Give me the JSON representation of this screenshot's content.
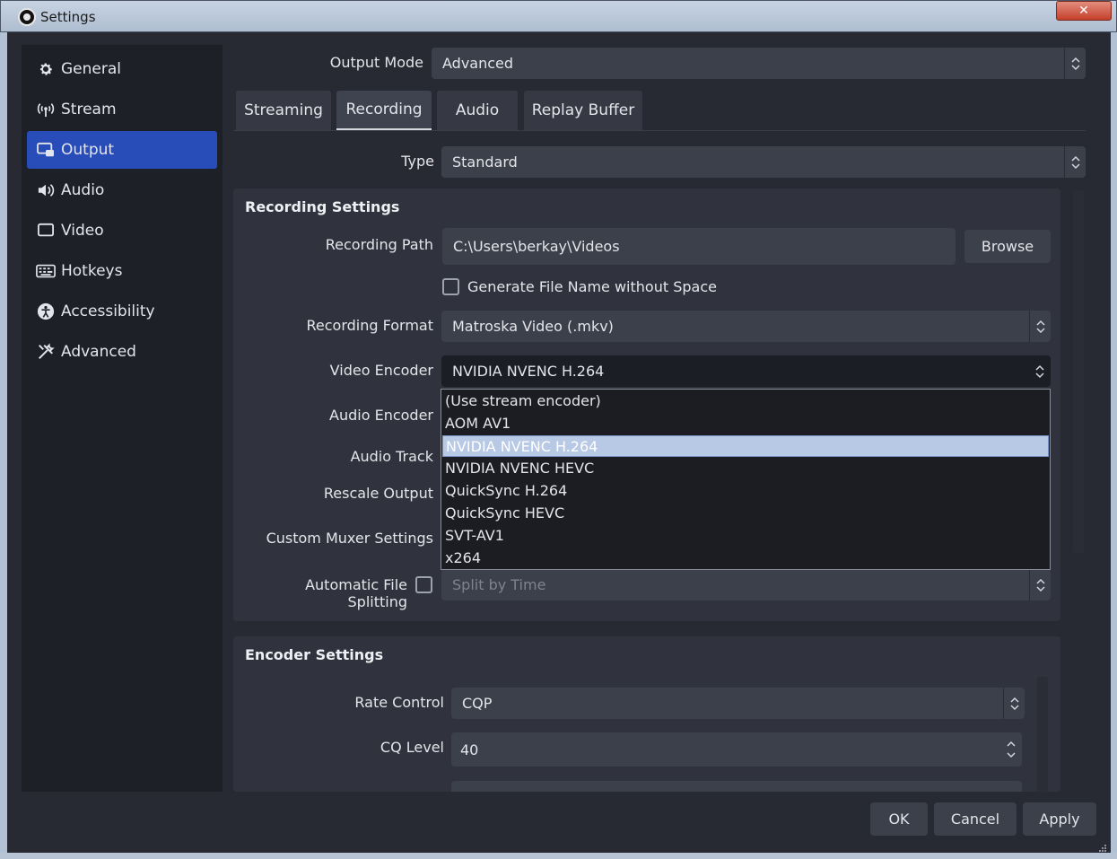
{
  "window": {
    "title": "Settings",
    "close_label": "✕"
  },
  "sidebar": {
    "items": [
      {
        "label": "General",
        "icon": "gear-icon"
      },
      {
        "label": "Stream",
        "icon": "antenna-icon"
      },
      {
        "label": "Output",
        "icon": "output-icon",
        "active": true
      },
      {
        "label": "Audio",
        "icon": "speaker-icon"
      },
      {
        "label": "Video",
        "icon": "monitor-icon"
      },
      {
        "label": "Hotkeys",
        "icon": "keyboard-icon"
      },
      {
        "label": "Accessibility",
        "icon": "accessibility-icon"
      },
      {
        "label": "Advanced",
        "icon": "tools-icon"
      }
    ]
  },
  "output": {
    "mode_label": "Output Mode",
    "mode_value": "Advanced",
    "tabs": [
      "Streaming",
      "Recording",
      "Audio",
      "Replay Buffer"
    ],
    "active_tab": "Recording",
    "type_label": "Type",
    "type_value": "Standard"
  },
  "recording_settings": {
    "title": "Recording Settings",
    "path_label": "Recording Path",
    "path_value": "C:\\Users\\berkay\\Videos",
    "browse_label": "Browse",
    "gen_filename_label": "Generate File Name without Space",
    "format_label": "Recording Format",
    "format_value": "Matroska Video (.mkv)",
    "video_encoder_label": "Video Encoder",
    "video_encoder_value": "NVIDIA NVENC H.264",
    "audio_encoder_label": "Audio Encoder",
    "audio_track_label": "Audio Track",
    "rescale_label": "Rescale Output",
    "muxer_label": "Custom Muxer Settings",
    "split_label": "Automatic File Splitting",
    "split_value": "Split by Time"
  },
  "encoder_dropdown": {
    "options": [
      "(Use stream encoder)",
      "AOM AV1",
      "NVIDIA NVENC H.264",
      "NVIDIA NVENC HEVC",
      "QuickSync H.264",
      "QuickSync HEVC",
      "SVT-AV1",
      "x264"
    ],
    "selected": "NVIDIA NVENC H.264"
  },
  "encoder_settings": {
    "title": "Encoder Settings",
    "rate_control_label": "Rate Control",
    "rate_control_value": "CQP",
    "cq_level_label": "CQ Level",
    "cq_level_value": "40"
  },
  "footer": {
    "ok": "OK",
    "cancel": "Cancel",
    "apply": "Apply"
  },
  "colors": {
    "accent": "#284cb8",
    "selection": "#b8c9e5",
    "panel": "#30333d"
  }
}
